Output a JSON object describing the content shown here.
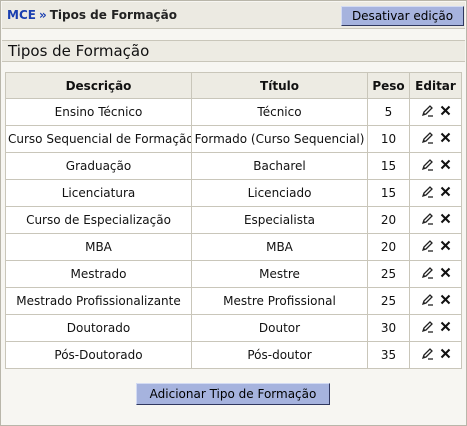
{
  "breadcrumb": {
    "root": "MCE",
    "separator": "»",
    "current": "Tipos de Formação"
  },
  "toolbar": {
    "edit_mode_label": "Desativar edição"
  },
  "page_title": "Tipos de Formação",
  "table": {
    "headers": [
      "Descrição",
      "Título",
      "Peso",
      "Editar"
    ],
    "rows": [
      {
        "descricao": "Ensino Técnico",
        "titulo": "Técnico",
        "peso": "5"
      },
      {
        "descricao": "Curso Sequencial de Formação",
        "titulo": "Formado (Curso Sequencial)",
        "peso": "10"
      },
      {
        "descricao": "Graduação",
        "titulo": "Bacharel",
        "peso": "15"
      },
      {
        "descricao": "Licenciatura",
        "titulo": "Licenciado",
        "peso": "15"
      },
      {
        "descricao": "Curso de Especialização",
        "titulo": "Especialista",
        "peso": "20"
      },
      {
        "descricao": "MBA",
        "titulo": "MBA",
        "peso": "20"
      },
      {
        "descricao": "Mestrado",
        "titulo": "Mestre",
        "peso": "25"
      },
      {
        "descricao": "Mestrado Profissionalizante",
        "titulo": "Mestre Profissional",
        "peso": "25"
      },
      {
        "descricao": "Doutorado",
        "titulo": "Doutor",
        "peso": "30"
      },
      {
        "descricao": "Pós-Doutorado",
        "titulo": "Pós-doutor",
        "peso": "35"
      }
    ],
    "row_actions": [
      "edit-pencil-icon",
      "delete-x-icon"
    ]
  },
  "add_button_label": "Adicionar Tipo de Formação",
  "colors": {
    "button_bg": "#a6b3de",
    "breadcrumb_link": "#1a3fb0",
    "header_bg": "#edebe3",
    "border": "#c9c6ba"
  }
}
